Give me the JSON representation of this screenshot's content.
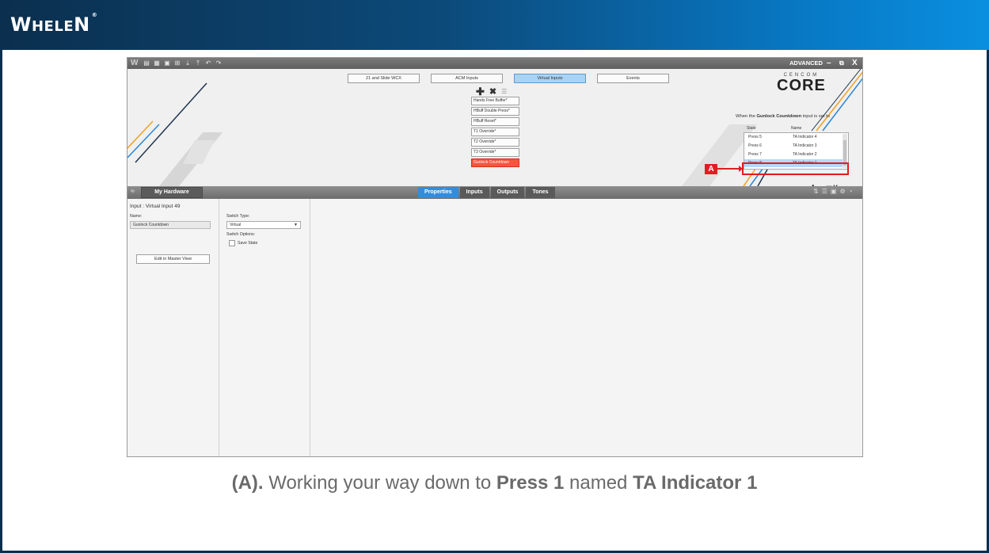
{
  "brand": {
    "logo_big_w": "W",
    "logo_rest": "HELE",
    "logo_n": "N",
    "logo_mark": "®"
  },
  "app": {
    "toolbar_mode": "ADVANCED",
    "top_tabs": [
      "21 and Slide WCX",
      "ACM Inputs",
      "Virtual Inputs",
      "Events"
    ],
    "active_top_tab": "Virtual Inputs",
    "virtual_inputs": [
      "Hands Free Buffer*",
      "HBuff Double Press*",
      "HBuff Reset*",
      "T1 Override*",
      "T2 Override*",
      "T3 Override*",
      "Gunlock Countdown"
    ],
    "selected_input": "Gunlock Countdown",
    "core_logo_small": "CENCOM",
    "core_logo_big": "CORE",
    "when_prefix": "When the",
    "when_input": "Gunlock Countdown",
    "when_suffix": "input is set to",
    "col_state": "State",
    "col_name": "Name",
    "mappings": [
      {
        "state": "Press 5",
        "name": "TA Indicator 4"
      },
      {
        "state": "Press 6",
        "name": "TA Indicator 3"
      },
      {
        "state": "Press 7",
        "name": "TA Indicator 2"
      },
      {
        "state": "Press 8",
        "name": "TA Indicator 1"
      }
    ],
    "callout_label": "A",
    "my_hardware": "My Hardware",
    "bottom_tabs": [
      "Properties",
      "Inputs",
      "Outputs",
      "Tones"
    ],
    "active_bottom_tab": "Properties",
    "input_title": "Input : Virtual Input 49",
    "name_label": "Name:",
    "name_value": "Gunlock Countdown",
    "edit_button": "Edit in Master View",
    "switch_type_label": "Switch Type:",
    "switch_type_value": "Virtual",
    "switch_options_label": "Switch Options:",
    "save_state_label": "Save State"
  },
  "caption": {
    "prefix": "(A).",
    "text1": "Working your way down to",
    "press": "Press 1",
    "text2": "named",
    "indicator": "TA Indicator 1"
  }
}
